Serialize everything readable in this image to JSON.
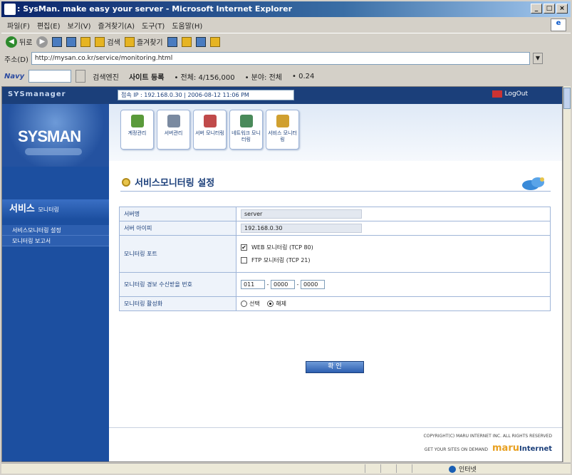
{
  "window": {
    "title": ": SysMan. make easy your server - Microsoft Internet Explorer"
  },
  "menubar": [
    "파일(F)",
    "편집(E)",
    "보기(V)",
    "즐겨찾기(A)",
    "도구(T)",
    "도움말(H)"
  ],
  "toolbar": {
    "back": "뒤로",
    "search": "검색",
    "favorites": "즐겨찾기"
  },
  "addressbar": {
    "label": "주소(D)",
    "url": "http://mysan.co.kr/service/monitoring.html"
  },
  "navybar": {
    "brand": "Navy",
    "search_label": "검색엔진",
    "site_reg": "사이트 등록",
    "total": "• 전체: 4/156,000",
    "category": "• 분야: 전체",
    "count": "• 0.24"
  },
  "site": {
    "brand_small": "SYSmanager",
    "server_info": "접속 IP : 192.168.0.30  |  2006-08-12 11:06 PM",
    "logout": "LogOut",
    "logo": "SYSMAN",
    "section": "서비스",
    "section_sub": "모니터링",
    "submenu": [
      "서비스모니터링 설정",
      "모니터링 보고서"
    ],
    "nav": [
      {
        "label": "계정관리",
        "color": "#5a9a3a"
      },
      {
        "label": "서버관리",
        "color": "#7a8aa0"
      },
      {
        "label": "서버 모니터링",
        "color": "#c04a4a"
      },
      {
        "label": "네트워크 모니터링",
        "color": "#4a8a5a"
      },
      {
        "label": "서비스 모니터링",
        "color": "#d0a030"
      }
    ],
    "page_title": "서비스모니터링 설정",
    "form": {
      "server_name_label": "서버명",
      "server_name_value": "server",
      "server_ip_label": "서버 아이피",
      "server_ip_value": "192.168.0.30",
      "monitor_target_label": "모니터링 포트",
      "web_monitor": "WEB 모니터링 (TCP 80)",
      "ftp_monitor": "FTP 모니터링 (TCP 21)",
      "sms_label": "모니터링 경보 수신받을 번호",
      "phone1": "011",
      "phone2": "0000",
      "phone3": "0000",
      "activate_label": "모니터링 활성화",
      "opt_on": "선택",
      "opt_off": "해제"
    },
    "confirm_label": "확 인",
    "copyright": "COPYRIGHT(C) MARU INTERNET INC. ALL RIGHTS RESERVED",
    "maru_small": "GET YOUR SITES ON DEMAND",
    "maru_brand1": "maru",
    "maru_brand2": "Internet"
  },
  "status": {
    "zone": "인터넷"
  }
}
